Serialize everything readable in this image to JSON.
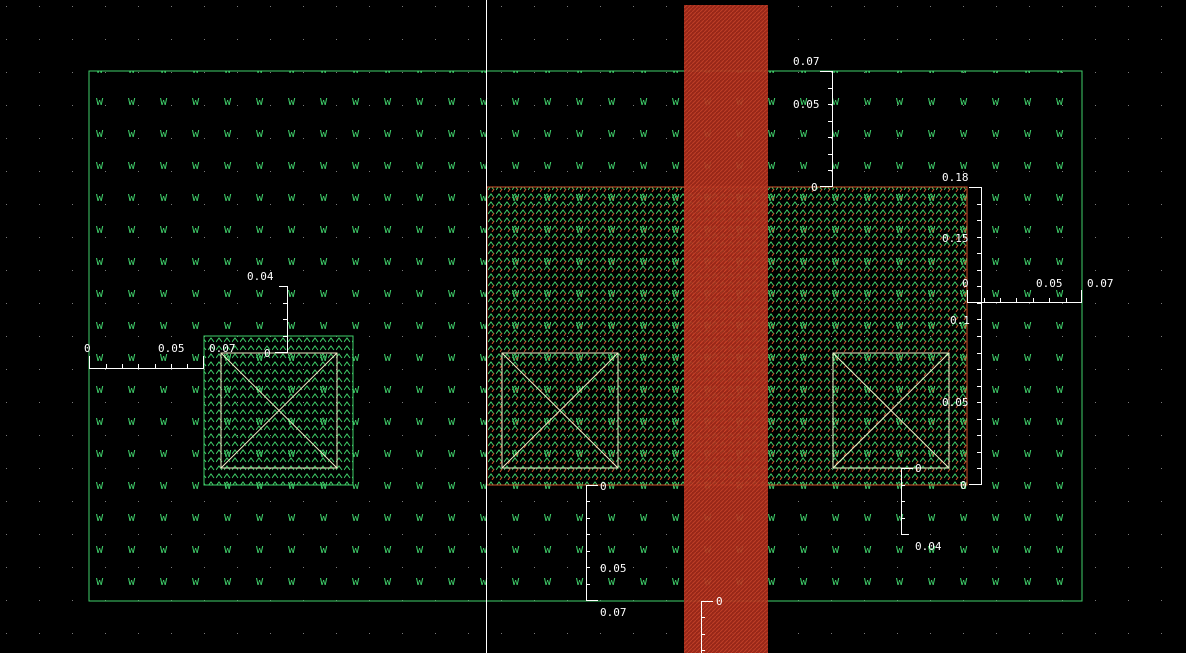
{
  "app": {
    "view": "layout-editor",
    "colors": {
      "background": "#000000",
      "grid_dot": "#7a7a7a",
      "well_outline": "#3fcf6a",
      "well_fill_mark": "#3fcf6a",
      "diffusion_fill": "#c94a2a",
      "poly_fill": "#b8321e",
      "contact_outline": "#f2f0c8",
      "ruler": "#ffffff",
      "crosshair": "#ffffff"
    },
    "well_mark": "w"
  },
  "rulers": {
    "left_horizontal": {
      "start": "0",
      "mid": "0.05",
      "end": "0.07"
    },
    "left_contact_vertical": {
      "top": "0.04",
      "bottom": "0"
    },
    "top_vertical": {
      "top": "0.07",
      "mid": "0.05",
      "bottom": "0"
    },
    "right_vertical": {
      "top": "0.18",
      "t2": "0.15",
      "t3": "0.1",
      "t4": "0.05",
      "bottom": "0"
    },
    "right_horizontal": {
      "start": "0",
      "mid": "0.05",
      "end": "0.07"
    },
    "bottom_vertical": {
      "top": "0",
      "mid": "0.05",
      "bottom": "0.07"
    },
    "right_contact_vertical": {
      "top": "0",
      "bottom": "0.04"
    },
    "poly_bottom": {
      "top": "0"
    }
  }
}
